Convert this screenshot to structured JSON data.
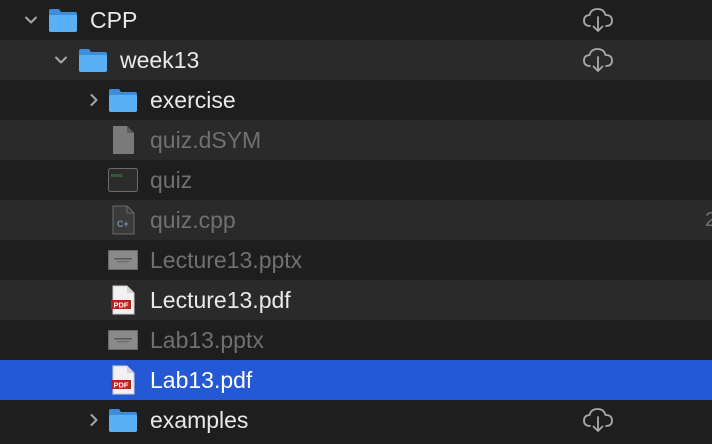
{
  "tree": {
    "items": [
      {
        "name": "CPP",
        "kind": "folder",
        "expanded": true,
        "dimmed": false,
        "cloud": true
      },
      {
        "name": "week13",
        "kind": "folder",
        "expanded": true,
        "dimmed": false,
        "cloud": true
      },
      {
        "name": "exercise",
        "kind": "folder",
        "expanded": false,
        "dimmed": false,
        "cloud": false
      },
      {
        "name": "quiz.dSYM",
        "kind": "generic-file",
        "dimmed": true
      },
      {
        "name": "quiz",
        "kind": "executable",
        "dimmed": true
      },
      {
        "name": "quiz.cpp",
        "kind": "cpp-source",
        "dimmed": true,
        "edge_text": "2"
      },
      {
        "name": "Lecture13.pptx",
        "kind": "pptx",
        "dimmed": true
      },
      {
        "name": "Lecture13.pdf",
        "kind": "pdf",
        "dimmed": false
      },
      {
        "name": "Lab13.pptx",
        "kind": "pptx",
        "dimmed": true
      },
      {
        "name": "Lab13.pdf",
        "kind": "pdf",
        "dimmed": false,
        "selected": true
      },
      {
        "name": "examples",
        "kind": "folder",
        "expanded": false,
        "dimmed": false,
        "cloud": true
      }
    ],
    "icons": {
      "folder": "folder-icon",
      "generic-file": "file-icon",
      "executable": "terminal-executable-icon",
      "cpp-source": "cpp-file-icon",
      "pptx": "presentation-file-icon",
      "pdf": "pdf-file-icon",
      "cloud": "cloud-download-icon",
      "expanded": "chevron-down-icon",
      "collapsed": "chevron-right-icon"
    },
    "icon_text": {
      "pdf_badge": "PDF",
      "cpp_badge": "C+",
      "terminal_prompt": "exec"
    },
    "colors": {
      "background": "#1e1e1e",
      "stripe": "#2a2a2a",
      "selection": "#2458d4",
      "folder": "#4fa6f0",
      "text": "#e9e9e9",
      "text_dimmed": "#707070",
      "pdf_red": "#b3261e"
    }
  }
}
